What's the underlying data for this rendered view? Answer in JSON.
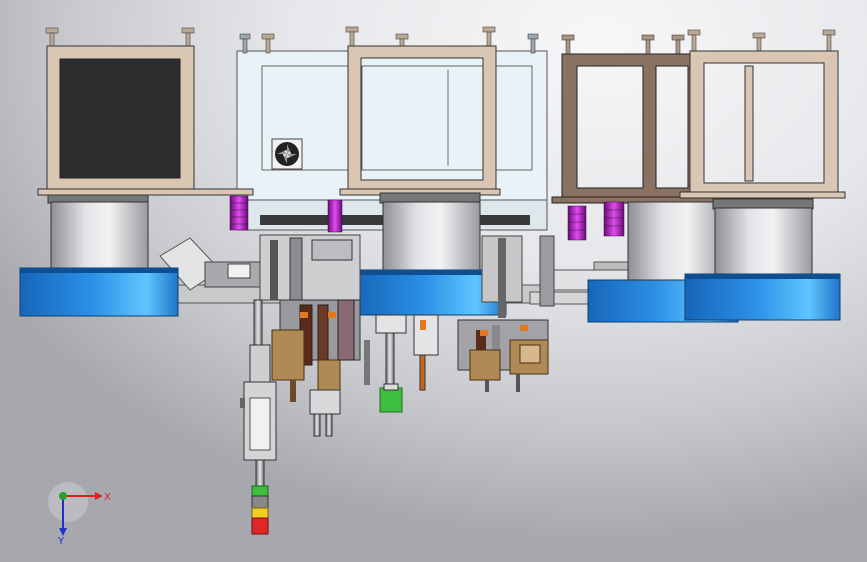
{
  "viewport": {
    "background": {
      "center": "#f7f7f9",
      "edge": "#a7a8ad"
    }
  },
  "colors": {
    "frame": "#d9c7b4",
    "frame_dark": "#8a7a6a",
    "frame_panel": "#2d2d30",
    "blue_ring": "#1b7fd6",
    "blue_light": "#4fb7f5",
    "steel": "#b8b9bc",
    "cabinet": "#e9f2f7",
    "magenta": "#b517c6",
    "tan": "#b08a56",
    "green": "#3fbf3f",
    "red": "#e02828",
    "yellow": "#f2cf22"
  },
  "triad": {
    "x_label": "X",
    "y_label": "Y",
    "x_color": "#e02020",
    "y_color": "#2f9a2f",
    "z_color": "#2030c8"
  }
}
